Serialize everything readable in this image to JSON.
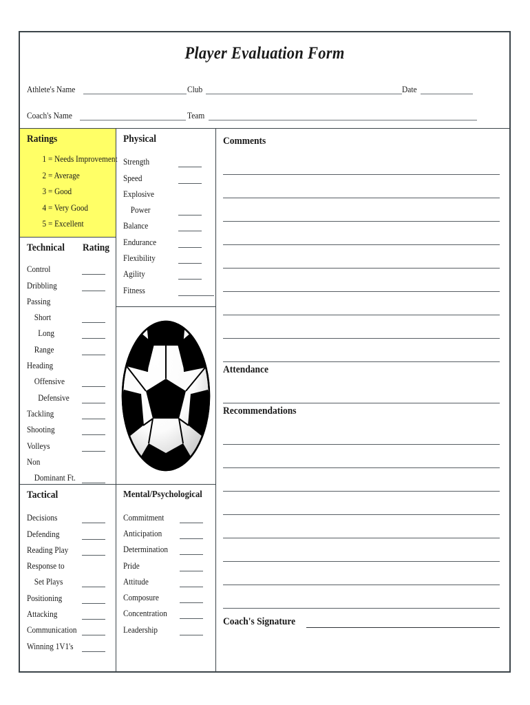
{
  "title": "Player Evaluation Form",
  "header": {
    "fields": [
      {
        "label": "Athlete's Name"
      },
      {
        "label": "Club"
      },
      {
        "label": "Date"
      },
      {
        "label": "Coach's Name"
      },
      {
        "label": "Team"
      }
    ]
  },
  "ratings": {
    "heading": "Ratings",
    "scale": [
      "1 = Needs Improvement",
      "2 = Average",
      "3 = Good",
      "4 = Very Good",
      "5 = Excellent"
    ],
    "background_color": "#ffff66"
  },
  "technical": {
    "heading": "Technical",
    "rating_heading": "Rating",
    "items": [
      {
        "label": "Control",
        "indent": 0,
        "line": true
      },
      {
        "label": "Dribbling",
        "indent": 0,
        "line": true
      },
      {
        "label": "Passing",
        "indent": 0,
        "line": false
      },
      {
        "label": "Short",
        "indent": 1,
        "line": true
      },
      {
        "label": "Long",
        "indent": 2,
        "line": true
      },
      {
        "label": "Range",
        "indent": 1,
        "line": true
      },
      {
        "label": "Heading",
        "indent": 0,
        "line": false
      },
      {
        "label": "Offensive",
        "indent": 1,
        "line": true
      },
      {
        "label": "Defensive",
        "indent": 2,
        "line": true
      },
      {
        "label": "Tackling",
        "indent": 0,
        "line": true
      },
      {
        "label": "Shooting",
        "indent": 0,
        "line": true
      },
      {
        "label": "Volleys",
        "indent": 0,
        "line": true
      },
      {
        "label": "Non",
        "indent": 0,
        "line": false
      },
      {
        "label": "Dominant Ft.",
        "indent": 1,
        "line": true
      }
    ]
  },
  "tactical": {
    "heading": "Tactical",
    "items": [
      {
        "label": "Decisions",
        "indent": 0,
        "line": true
      },
      {
        "label": "Defending",
        "indent": 0,
        "line": true
      },
      {
        "label": "Reading Play",
        "indent": 0,
        "line": true
      },
      {
        "label": "Response to",
        "indent": 0,
        "line": false
      },
      {
        "label": "Set Plays",
        "indent": 1,
        "line": true
      },
      {
        "label": "Positioning",
        "indent": 0,
        "line": true
      },
      {
        "label": "Attacking",
        "indent": 0,
        "line": true
      },
      {
        "label": "Communication",
        "indent": 0,
        "line": true
      },
      {
        "label": "Winning 1V1's",
        "indent": 0,
        "line": true
      }
    ]
  },
  "physical": {
    "heading": "Physical",
    "items": [
      {
        "label": "Strength",
        "indent": 0,
        "line": true,
        "wide": false
      },
      {
        "label": "Speed",
        "indent": 0,
        "line": true,
        "wide": false
      },
      {
        "label": "Explosive",
        "indent": 0,
        "line": false,
        "wide": false
      },
      {
        "label": "Power",
        "indent": 1,
        "line": true,
        "wide": false
      },
      {
        "label": "Balance",
        "indent": 0,
        "line": true,
        "wide": false
      },
      {
        "label": "Endurance",
        "indent": 0,
        "line": true,
        "wide": false
      },
      {
        "label": "Flexibility",
        "indent": 0,
        "line": true,
        "wide": false
      },
      {
        "label": "Agility",
        "indent": 0,
        "line": true,
        "wide": false
      },
      {
        "label": "Fitness",
        "indent": 0,
        "line": true,
        "wide": true
      }
    ]
  },
  "mental": {
    "heading": "Mental/Psychological",
    "items": [
      {
        "label": "Commitment",
        "indent": 0,
        "line": true
      },
      {
        "label": "Anticipation",
        "indent": 0,
        "line": true
      },
      {
        "label": "Determination",
        "indent": 0,
        "line": true
      },
      {
        "label": "Pride",
        "indent": 0,
        "line": true
      },
      {
        "label": "Attitude",
        "indent": 0,
        "line": true
      },
      {
        "label": "Composure",
        "indent": 0,
        "line": true
      },
      {
        "label": "Concentration",
        "indent": 0,
        "line": true
      },
      {
        "label": "Leadership",
        "indent": 0,
        "line": true
      }
    ]
  },
  "illustration": {
    "name": "soccer-ball-graphic"
  },
  "right_column": {
    "comments_heading": "Comments",
    "comments_lines": 9,
    "attendance_heading": "Attendance",
    "attendance_lines": 1,
    "recommendations_heading": "Recommendations",
    "recommendations_lines": 8,
    "signature_label": "Coach's Signature"
  }
}
